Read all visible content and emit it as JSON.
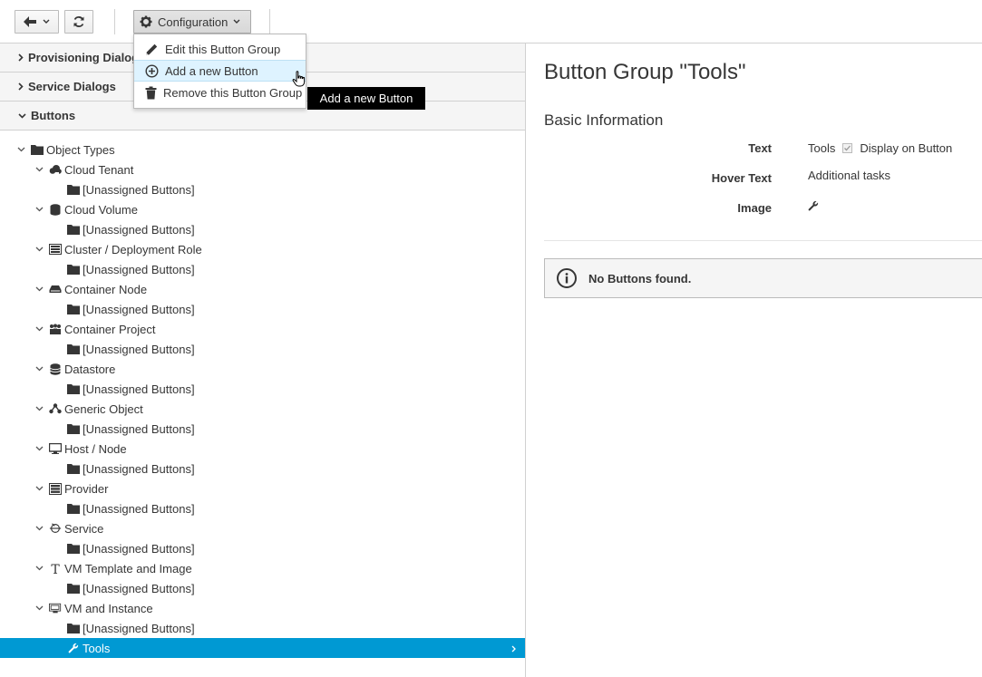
{
  "toolbar": {
    "configuration_label": "Configuration"
  },
  "config_menu": {
    "items": [
      {
        "label": "Edit this Button Group",
        "icon": "pencil-icon"
      },
      {
        "label": "Add a new Button",
        "icon": "plus-circle-icon"
      },
      {
        "label": "Remove this Button Group",
        "icon": "trash-icon"
      }
    ]
  },
  "tooltip": "Add a new Button",
  "accordion": {
    "sections": [
      {
        "label": "Provisioning Dialogs",
        "expanded": false
      },
      {
        "label": "Service Dialogs",
        "expanded": false
      },
      {
        "label": "Buttons",
        "expanded": true
      }
    ]
  },
  "tree": {
    "root": "Object Types",
    "object_types": [
      {
        "label": "Cloud Tenant",
        "icon": "cloud-tenant-icon",
        "child": "[Unassigned Buttons]"
      },
      {
        "label": "Cloud Volume",
        "icon": "cloud-volume-icon",
        "child": "[Unassigned Buttons]"
      },
      {
        "label": "Cluster / Deployment Role",
        "icon": "cluster-icon",
        "child": "[Unassigned Buttons]"
      },
      {
        "label": "Container Node",
        "icon": "container-node-icon",
        "child": "[Unassigned Buttons]"
      },
      {
        "label": "Container Project",
        "icon": "container-project-icon",
        "child": "[Unassigned Buttons]"
      },
      {
        "label": "Datastore",
        "icon": "datastore-icon",
        "child": "[Unassigned Buttons]"
      },
      {
        "label": "Generic Object",
        "icon": "generic-object-icon",
        "child": "[Unassigned Buttons]"
      },
      {
        "label": "Host / Node",
        "icon": "host-icon",
        "child": "[Unassigned Buttons]"
      },
      {
        "label": "Provider",
        "icon": "provider-icon",
        "child": "[Unassigned Buttons]"
      },
      {
        "label": "Service",
        "icon": "service-icon",
        "child": "[Unassigned Buttons]"
      },
      {
        "label": "VM Template and Image",
        "icon": "template-icon",
        "child": "[Unassigned Buttons]"
      },
      {
        "label": "VM and Instance",
        "icon": "vm-icon",
        "child": "[Unassigned Buttons]"
      }
    ],
    "selected": "Tools"
  },
  "detail": {
    "title": "Button Group \"Tools\"",
    "section": "Basic Information",
    "text_label": "Text",
    "text_value": "Tools",
    "display_on_button_label": "Display on Button",
    "display_on_button_checked": true,
    "hover_label": "Hover Text",
    "hover_value": "Additional tasks",
    "image_label": "Image",
    "image_icon": "wrench-icon",
    "alert": "No Buttons found."
  },
  "colors": {
    "selected_row": "#0099d3",
    "menu_hover": "#def3ff"
  }
}
